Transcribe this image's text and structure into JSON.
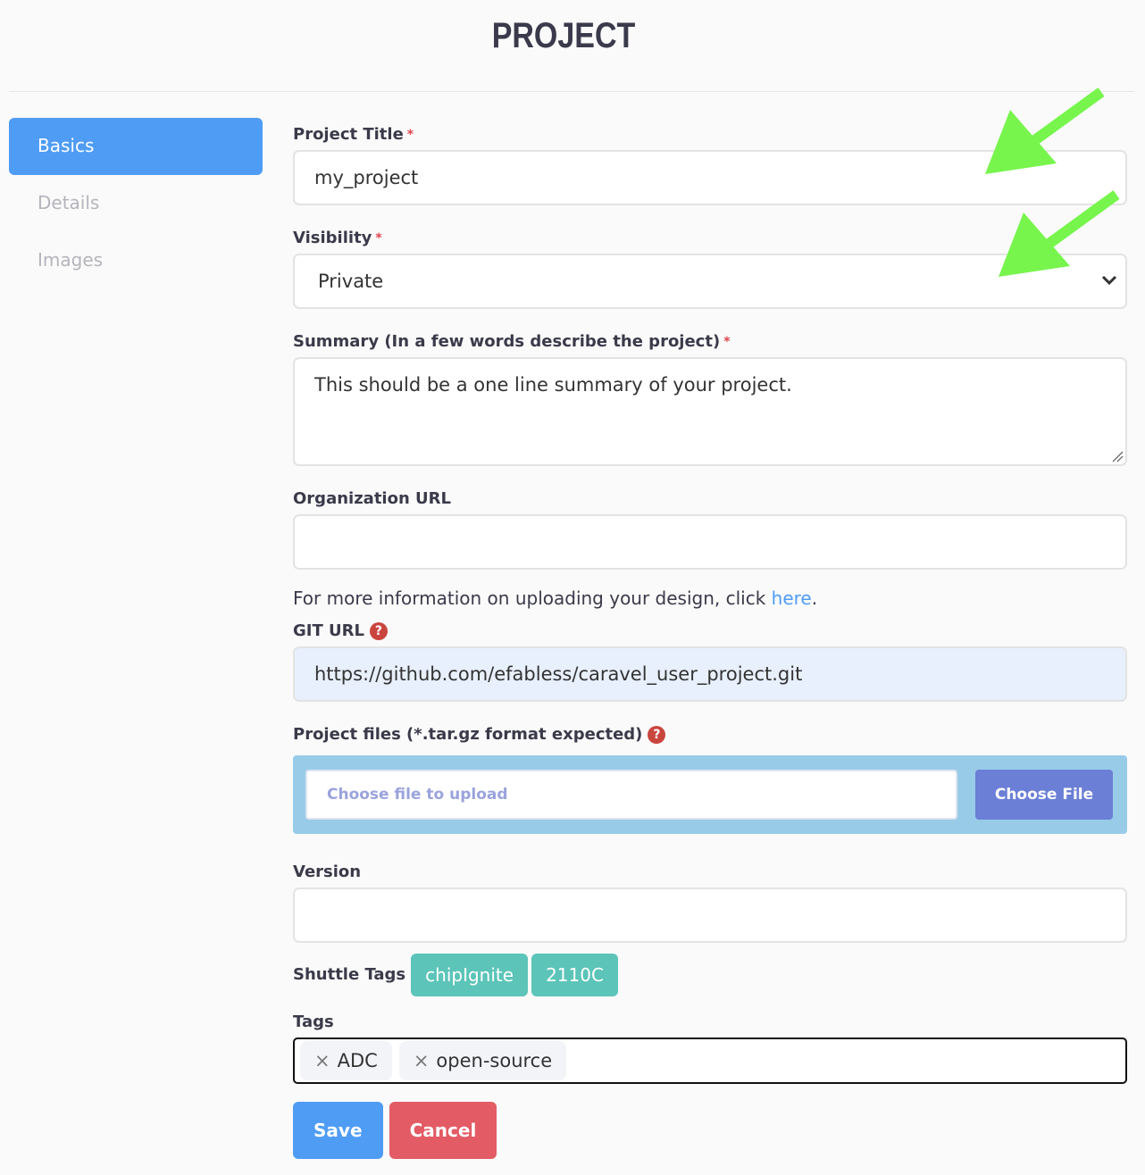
{
  "page": {
    "title": "PROJECT"
  },
  "sidebar": {
    "items": [
      {
        "label": "Basics",
        "active": true
      },
      {
        "label": "Details"
      },
      {
        "label": "Images"
      }
    ]
  },
  "form": {
    "project_title": {
      "label": "Project Title",
      "required": "*",
      "value": "my_project"
    },
    "visibility": {
      "label": "Visibility",
      "required": "*",
      "value": "Private"
    },
    "summary": {
      "label": "Summary (In a few words describe the project)",
      "required": "*",
      "value": "This should be a one line summary of your project."
    },
    "org_url": {
      "label": "Organization URL",
      "value": ""
    },
    "info": {
      "text": "For more information on uploading your design, click ",
      "link": "here",
      "end": "."
    },
    "git_url": {
      "label": "GIT URL",
      "value": "https://github.com/efabless/caravel_user_project.git",
      "help": "?"
    },
    "files": {
      "label": "Project files (*.tar.gz format expected)",
      "help": "?",
      "placeholder": "Choose file to upload",
      "button": "Choose File"
    },
    "version": {
      "label": "Version",
      "value": ""
    },
    "shuttle_tags": {
      "label": "Shuttle Tags",
      "items": [
        "chipIgnite",
        "2110C"
      ]
    },
    "tags": {
      "label": "Tags",
      "items": [
        "ADC",
        "open-source"
      ],
      "remove_icon": "×"
    },
    "save": "Save",
    "cancel": "Cancel"
  },
  "colors": {
    "primary": "#4f9cf5",
    "danger": "#e35b64",
    "chip": "#5cc4b8",
    "annotation_arrow": "#77f54d"
  }
}
